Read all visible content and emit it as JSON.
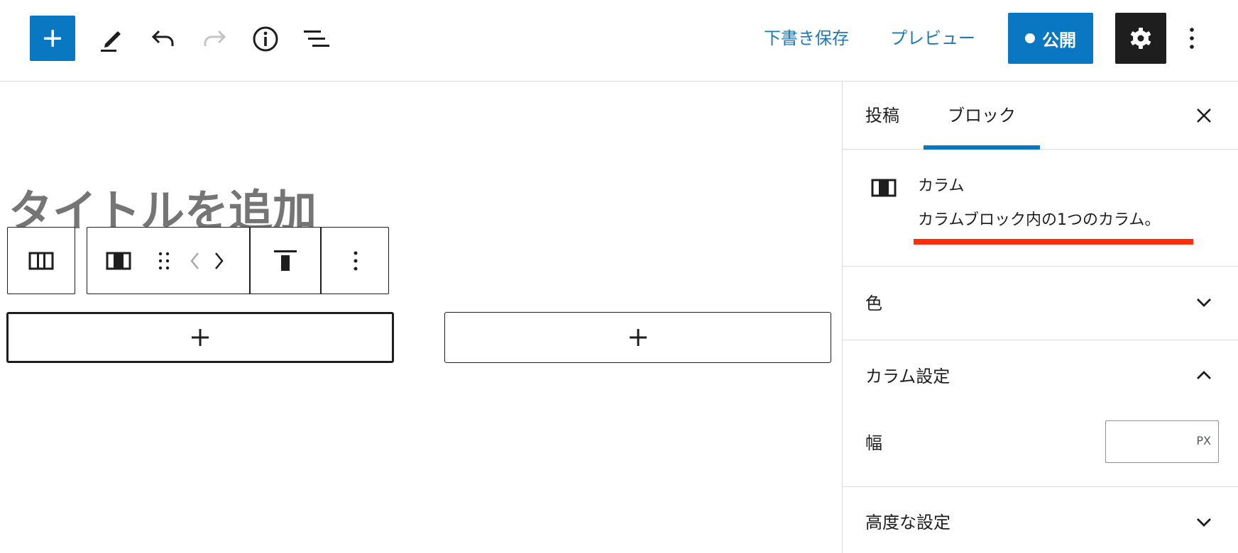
{
  "toolbar": {
    "save_draft_label": "下書き保存",
    "preview_label": "プレビュー",
    "publish_label": "公開"
  },
  "editor": {
    "title_placeholder": "タイトルを追加"
  },
  "sidebar": {
    "tabs": [
      {
        "label": "投稿",
        "active": false
      },
      {
        "label": "ブロック",
        "active": true
      }
    ],
    "block_card": {
      "title": "カラム",
      "description": "カラムブロック内の1つのカラム。"
    },
    "panels": {
      "color": {
        "title": "色",
        "expanded": false
      },
      "column_settings": {
        "title": "カラム設定",
        "expanded": true
      },
      "advanced": {
        "title": "高度な設定",
        "expanded": false
      }
    },
    "width_field": {
      "label": "幅",
      "value": "",
      "unit": "PX"
    }
  },
  "colors": {
    "accent": "#0a77c2",
    "highlight_underline": "#ff2d0a",
    "dark": "#1e1e1e"
  }
}
